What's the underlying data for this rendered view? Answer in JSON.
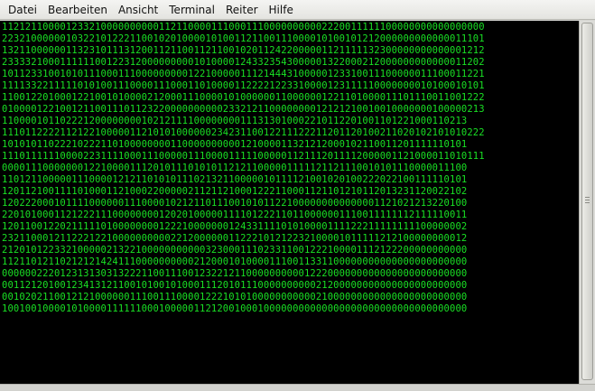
{
  "menu": [
    "Datei",
    "Bearbeiten",
    "Ansicht",
    "Terminal",
    "Reiter",
    "Hilfe"
  ],
  "colors": {
    "terminal_bg": "#000000",
    "terminal_text": "#19e024",
    "menubar": "#ececea"
  },
  "terminal": {
    "lines": [
      "11212110000123321000000000011211000011100011100000000002220011111100000000000000000",
      "22321000000103221012221100102010000101001121100111000010100101212000000000000011101",
      "13211000000113231011131200112110011211001020112422000001121111132300000000000001212",
      "23333210001111110012231200000000010100001243323543000001322000212000000000000011202",
      "10112331001010111000111000000000122100000111214443100000123310011100000011100011221",
      "11113322111110101001110000111000110100001122221223310000123111110000000010100010101",
      "11001220100012210010100002120001110000101000000110000001221101000011101110011001222",
      "01000012210012110011101123220000000000233212110000000012121210010010000000100000213",
      "11000010110222120000000010212111100000000111313010002210112201001101221000110213",
      "11101122221121221000001121010100000023423110012211122211201120100211020102101010222",
      "10101011022210222110100000000110000000000121000011321212000102110011201111110101",
      "11101111110000223111100011100000111000011111000001121112011112000001121000011010111",
      "00001110000000122100001112010111010101121211000001111121121110010101110000011100",
      "11012110000011100001212110101011102132110000010111121001020100222022100111110101",
      "12011210011110100011210002200000211211210001222110001121101210112013231120022102",
      "12022200010111100000011100001021211011100101011221000000000000001121021213220100",
      "22010100011212221110000000012020100000111101222110110000001110011111112111110011",
      "12011001220211111010000000012221000000012433111101010000111122211111111100000002",
      "23211000121122212210000000000221200000011222101212232100001011111212100000000012",
      "21201012233210000021322100000000000323000111023311001222100001112122200000000000",
      "11211012110212121424111000000000021200010100001110011331100000000000000000000000",
      "00000022201231313031322211001110012322121100000000001222000000000000000000000000",
      "00112120100123413121100101001010001112010111000000000021200000000000000000000000",
      "00102021100121210000001110011100001222101010000000000021000000000000000000000000",
      "10010010000101000011111100010000011212001000100000000000000000000000000000000000"
    ]
  }
}
